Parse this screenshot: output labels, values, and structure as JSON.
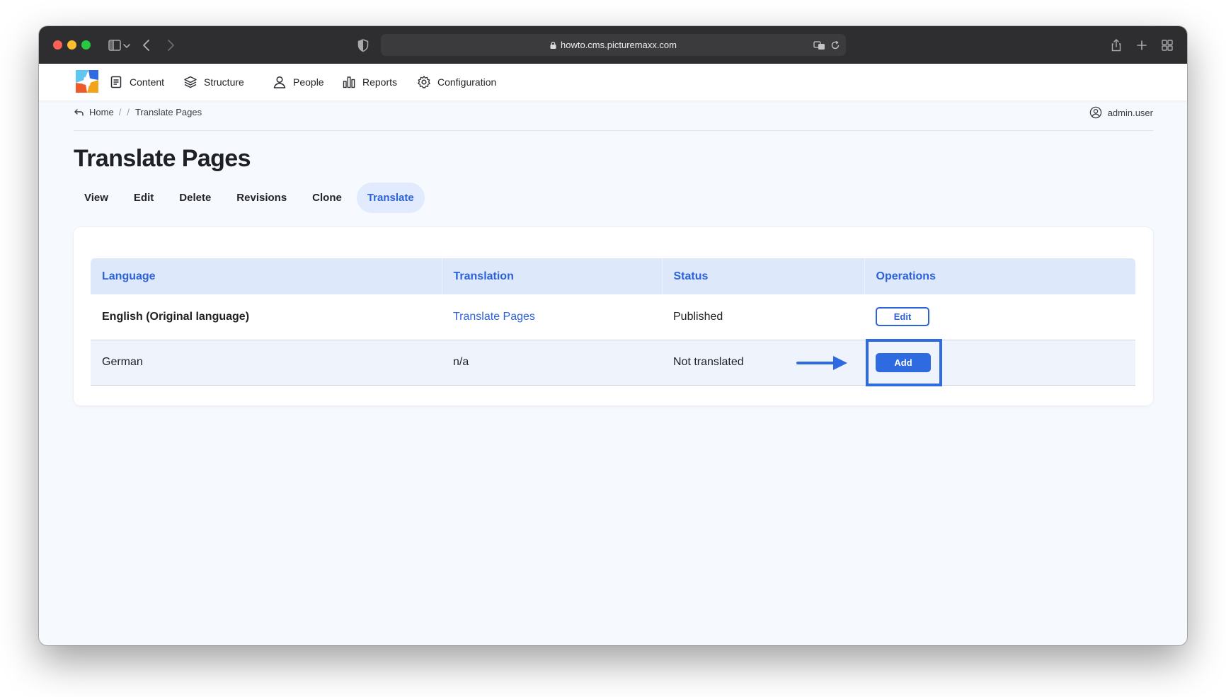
{
  "browser": {
    "url": "howto.cms.picturemaxx.com"
  },
  "nav": {
    "items": [
      {
        "label": "Content",
        "icon": "document-icon"
      },
      {
        "label": "Structure",
        "icon": "layers-icon"
      },
      {
        "label": "People",
        "icon": "person-icon"
      },
      {
        "label": "Reports",
        "icon": "bar-chart-icon"
      },
      {
        "label": "Configuration",
        "icon": "gear-icon"
      }
    ]
  },
  "breadcrumb": {
    "home": "Home",
    "separator": "/",
    "current": "Translate Pages"
  },
  "user": {
    "name": "admin.user"
  },
  "page": {
    "title": "Translate Pages"
  },
  "tabs": [
    {
      "label": "View",
      "active": false
    },
    {
      "label": "Edit",
      "active": false
    },
    {
      "label": "Delete",
      "active": false
    },
    {
      "label": "Revisions",
      "active": false
    },
    {
      "label": "Clone",
      "active": false
    },
    {
      "label": "Translate",
      "active": true
    }
  ],
  "table": {
    "headers": [
      "Language",
      "Translation",
      "Status",
      "Operations"
    ],
    "rows": [
      {
        "language": "English (Original language)",
        "translation": "Translate Pages",
        "status": "Published",
        "operation": "Edit"
      },
      {
        "language": "German",
        "translation": "n/a",
        "status": "Not translated",
        "operation": "Add"
      }
    ]
  },
  "colors": {
    "accent": "#2d63d8",
    "highlight": "#2f6be0",
    "header_bg": "#dde8fb"
  }
}
